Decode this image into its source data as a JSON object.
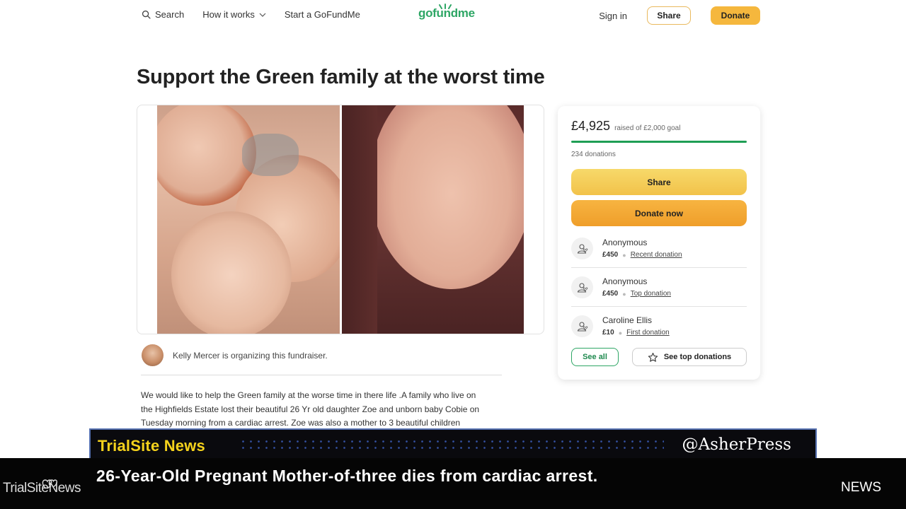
{
  "header": {
    "search_label": "Search",
    "how_it_works_label": "How it works",
    "start_label": "Start a GoFundMe",
    "logo_text": "gofundme",
    "sign_in_label": "Sign in",
    "share_label": "Share",
    "donate_label": "Donate"
  },
  "campaign": {
    "title": "Support the Green family at the worst time",
    "organizer_text": "Kelly Mercer is organizing this fundraiser.",
    "story_lines": [
      "We would like to help the Green family at the worse time in there life .A family who live on",
      "the Highfields Estate lost their beautiful 26 Yr old daughter Zoe and unborn baby Cobie on",
      "Tuesday morning from a cardiac arrest. Zoe was also a mother to 3 beautiful children"
    ]
  },
  "donation_panel": {
    "raised_amount": "£4,925",
    "raised_goal": "raised of £2,000 goal",
    "progress_fraction": 1.0,
    "donation_count": "234 donations",
    "share_label": "Share",
    "donate_now_label": "Donate now",
    "donors": [
      {
        "name": "Anonymous",
        "amount": "£450",
        "tag": "Recent donation"
      },
      {
        "name": "Anonymous",
        "amount": "£450",
        "tag": "Top donation"
      },
      {
        "name": "Caroline Ellis",
        "amount": "£10",
        "tag": "First donation"
      }
    ],
    "see_all_label": "See all",
    "see_top_label": "See top donations"
  },
  "news_overlay": {
    "brand": "TrialSite News",
    "handle": "@AsherPress",
    "headline": "26-Year-Old Pregnant Mother-of-three dies from cardiac arrest.",
    "section_label": "NEWS",
    "corner_logo": "TrialSiteNews"
  },
  "colors": {
    "brand_green": "#2ea665",
    "accent_yellow": "#f5b73d",
    "news_yellow": "#f5d21c"
  }
}
